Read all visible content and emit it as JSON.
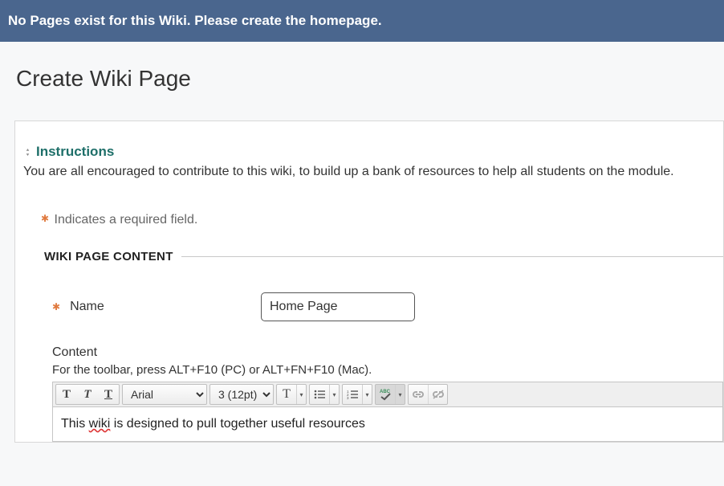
{
  "banner": {
    "message": "No Pages exist for this Wiki. Please create the homepage."
  },
  "page": {
    "title": "Create Wiki Page"
  },
  "instructions": {
    "heading": "Instructions",
    "text": "You are all encouraged to contribute to this wiki, to build up a bank of resources to help all students on the module."
  },
  "required_note": "Indicates a required field.",
  "section": {
    "heading": "WIKI PAGE CONTENT"
  },
  "fields": {
    "name": {
      "label": "Name",
      "value": "Home Page"
    },
    "content": {
      "label": "Content",
      "toolbar_hint": "For the toolbar, press ALT+F10 (PC) or ALT+FN+F10 (Mac).",
      "font": "Arial",
      "size": "3 (12pt)",
      "body_prefix": "This ",
      "body_misspelled": "wiki",
      "body_suffix": " is designed to pull together useful resources"
    }
  }
}
